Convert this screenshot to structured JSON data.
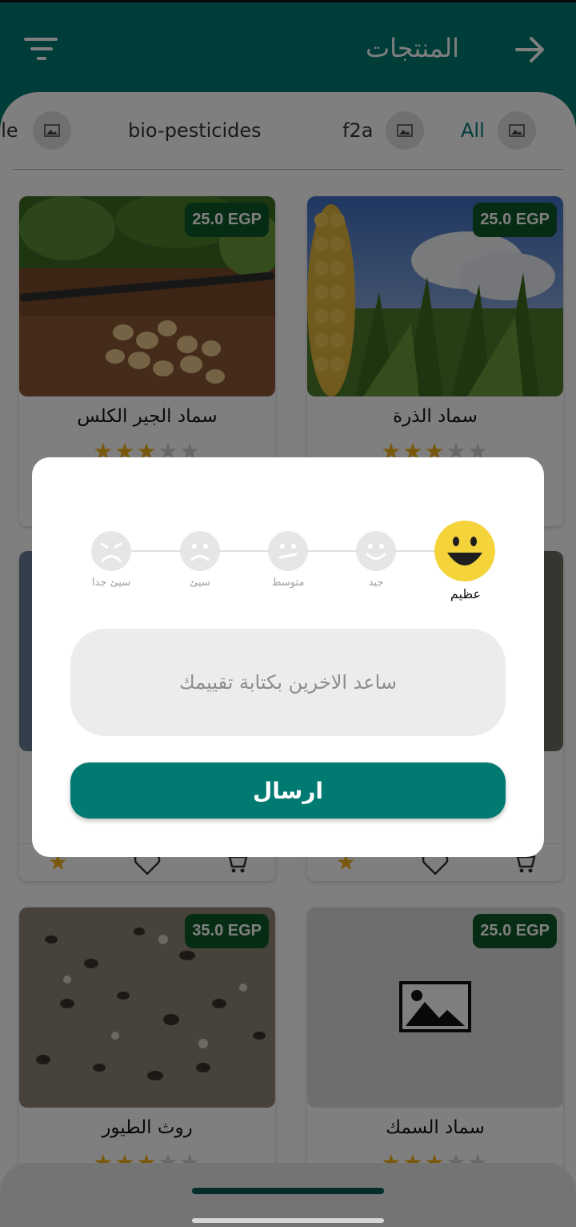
{
  "header": {
    "title": "المنتجات",
    "back_icon": "arrow-right-icon",
    "filter_icon": "filter-icon"
  },
  "categories": [
    {
      "label": "All",
      "active": true
    },
    {
      "label": "f2a",
      "active": false
    },
    {
      "label": "bio-pesticides",
      "active": false
    },
    {
      "label": "ble",
      "active": false
    }
  ],
  "products": [
    {
      "name": "سماد الذرة",
      "price": "25.0 EGP",
      "rating": 3
    },
    {
      "name": "سماد الجير الكلس",
      "price": "25.0 EGP",
      "rating": 3
    },
    {
      "name": "سماد السمك",
      "price": "25.0 EGP",
      "rating": 3
    },
    {
      "name": "روث الطيور",
      "price": "35.0 EGP",
      "rating": 3
    }
  ],
  "dialog": {
    "ratings": [
      {
        "label": "عظيم",
        "selected": true
      },
      {
        "label": "جيد",
        "selected": false
      },
      {
        "label": "متوسط",
        "selected": false
      },
      {
        "label": "سيئ",
        "selected": false
      },
      {
        "label": "سيئ جدا",
        "selected": false
      }
    ],
    "review_placeholder": "ساعد الاخرين بكتابة تقييمك",
    "send_label": "ارسال"
  },
  "colors": {
    "primary": "#017b72",
    "price_badge": "#0c5b26",
    "star": "#f2b21b",
    "selected_face": "#f4d33b"
  }
}
